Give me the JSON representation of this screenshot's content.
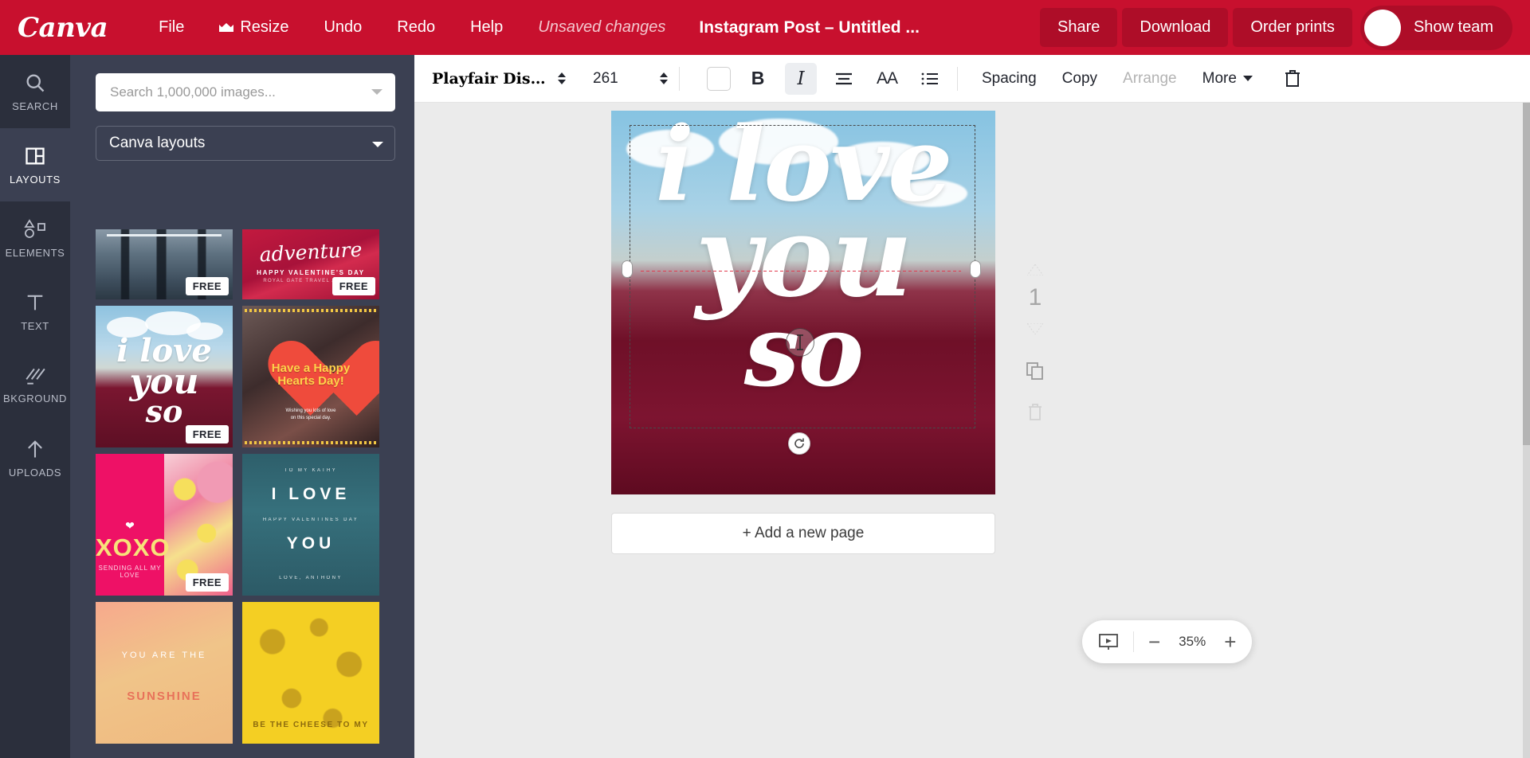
{
  "topbar": {
    "logo": "Canva",
    "menus": [
      {
        "label": "File",
        "icon": null
      },
      {
        "label": "Resize",
        "icon": "crown-icon"
      },
      {
        "label": "Undo",
        "icon": null
      },
      {
        "label": "Redo",
        "icon": null
      },
      {
        "label": "Help",
        "icon": null
      }
    ],
    "status": "Unsaved changes",
    "title": "Instagram Post – Untitled ...",
    "share_label": "Share",
    "download_label": "Download",
    "order_prints_label": "Order prints",
    "show_team_label": "Show team",
    "brand_color": "#c8102e"
  },
  "rail": {
    "items": [
      {
        "label": "SEARCH",
        "icon": "search-icon",
        "active": false
      },
      {
        "label": "LAYOUTS",
        "icon": "layouts-icon",
        "active": true
      },
      {
        "label": "ELEMENTS",
        "icon": "elements-icon",
        "active": false
      },
      {
        "label": "TEXT",
        "icon": "text-icon",
        "active": false
      },
      {
        "label": "BKGROUND",
        "icon": "background-icon",
        "active": false
      },
      {
        "label": "UPLOADS",
        "icon": "upload-icon",
        "active": false
      }
    ]
  },
  "panel": {
    "search_placeholder": "Search 1,000,000 images...",
    "search_value": "",
    "category": "Canva layouts",
    "thumbnails": [
      {
        "name": "forest-layout",
        "badge": "FREE"
      },
      {
        "name": "adventure-layout",
        "badge": "FREE",
        "word": "adventure",
        "line1": "HAPPY VALENTINE'S DAY",
        "line2": "ROYAL GATE TRAVEL AGENCY"
      },
      {
        "name": "i-love-you-so-layout",
        "badge": "FREE",
        "l1": "i love",
        "l2": "you",
        "l3": "so"
      },
      {
        "name": "happy-hearts-day-layout",
        "badge": "",
        "title": "Have a Happy\nHearts Day!",
        "sub": "Wishing you lots of love\non this special day."
      },
      {
        "name": "xoxo-layout",
        "badge": "FREE",
        "word": "XOXO",
        "sub": "SENDING ALL MY LOVE"
      },
      {
        "name": "i-love-you-teal-layout",
        "badge": "",
        "pre": "TO MY KATHY",
        "big1": "I LOVE",
        "mid": "HAPPY VALENTINES DAY",
        "big2": "YOU",
        "post": "LOVE, ANTHONY"
      },
      {
        "name": "you-are-the-layout",
        "badge": "",
        "line1": "YOU ARE THE",
        "line2": "SUNSHINE"
      },
      {
        "name": "cheese-layout",
        "badge": "",
        "line1": "BE THE CHEESE TO MY"
      }
    ]
  },
  "toolbar": {
    "font_family": "Playfair Displ...",
    "font_size": "261",
    "text_color": "#ffffff",
    "bold_label": "B",
    "italic_label": "I",
    "italic_active": true,
    "case_label": "AA",
    "align_icon": "align-left-icon",
    "list_icon": "bullet-list-icon",
    "spacing_label": "Spacing",
    "copy_label": "Copy",
    "arrange_label": "Arrange",
    "arrange_disabled": true,
    "more_label": "More",
    "delete_icon": "trash-icon"
  },
  "canvas": {
    "design_text": {
      "line1": "i love",
      "line2": "you",
      "line3": "so"
    },
    "add_page_label": "+ Add a new page",
    "page_number": "1",
    "zoom_level": "35%",
    "zoom_out": "−",
    "zoom_in": "+",
    "present_icon": "present-icon",
    "duplicate_icon": "duplicate-page-icon",
    "delete_page_icon": "delete-page-icon"
  }
}
